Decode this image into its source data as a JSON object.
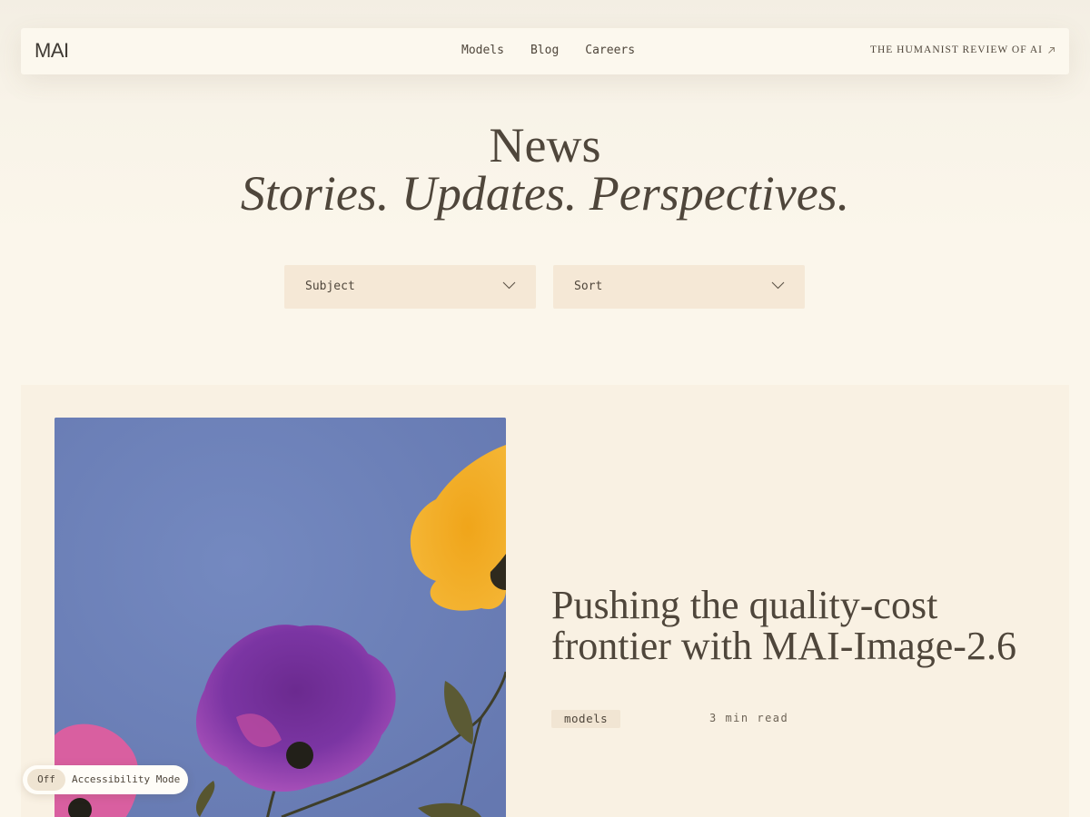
{
  "header": {
    "logo": "MAI",
    "nav": [
      {
        "label": "Models"
      },
      {
        "label": "Blog"
      },
      {
        "label": "Careers"
      }
    ],
    "external_link": "THE HUMANIST REVIEW OF AI"
  },
  "hero": {
    "title": "News",
    "subtitle": "Stories. Updates. Perspectives."
  },
  "filters": {
    "subject_label": "Subject",
    "sort_label": "Sort"
  },
  "featured": {
    "title": "Pushing the quality-cost frontier with MAI-Image-2.6",
    "tag": "models",
    "read_time": "3 min read"
  },
  "accessibility": {
    "state": "Off",
    "label": "Accessibility Mode"
  },
  "colors": {
    "background": "#fbf6eb",
    "text": "#4f463b",
    "filter_bg": "#f5e8d6",
    "article_bg": "#f9f1e3",
    "image_sky": "#6e82b8"
  }
}
